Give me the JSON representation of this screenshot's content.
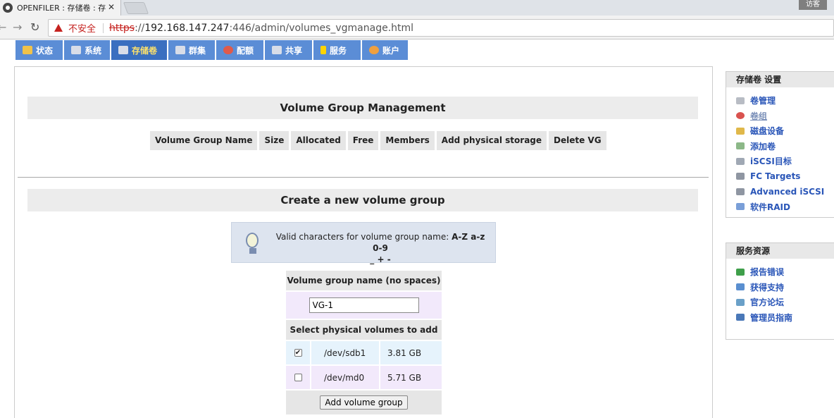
{
  "browser": {
    "tab_title": "OPENFILER : 存储卷 : 存",
    "tab_close": "✕",
    "visitor_label": "访客",
    "insecure_label": "不安全",
    "url_scheme": "https",
    "url_sep": "://",
    "url_host": "192.168.147.247",
    "url_rest": ":446/admin/volumes_vgmanage.html"
  },
  "nav": {
    "tabs": [
      {
        "label": "状态",
        "icon": "status-icon",
        "color": "#f0c24a"
      },
      {
        "label": "系统",
        "icon": "system-icon",
        "color": "#d8dde8"
      },
      {
        "label": "存储卷",
        "icon": "volumes-icon",
        "color": "#d8dde8"
      },
      {
        "label": "群集",
        "icon": "cluster-icon",
        "color": "#d8dde8"
      },
      {
        "label": "配额",
        "icon": "quota-icon",
        "color": "#e05a4a"
      },
      {
        "label": "共享",
        "icon": "shares-icon",
        "color": "#d8dde8"
      },
      {
        "label": "服务",
        "icon": "services-icon",
        "color": "#ffd400"
      },
      {
        "label": "账户",
        "icon": "accounts-icon",
        "color": "#f0a040"
      }
    ]
  },
  "vg_management": {
    "title": "Volume Group Management",
    "columns": [
      "Volume Group Name",
      "Size",
      "Allocated",
      "Free",
      "Members",
      "Add physical storage",
      "Delete VG"
    ]
  },
  "create_vg": {
    "title": "Create a new volume group",
    "tip_text": "Valid characters for volume group name: ",
    "tip_chars_1": "A-Z a-z 0-9",
    "tip_chars_2": "_ + -",
    "name_header": "Volume group name (no spaces)",
    "name_value": "VG-1",
    "pv_header": "Select physical volumes to add",
    "pvs": [
      {
        "device": "/dev/sdb1",
        "size": "3.81 GB",
        "checked": true
      },
      {
        "device": "/dev/md0",
        "size": "5.71 GB",
        "checked": false
      }
    ],
    "submit_label": "Add volume group"
  },
  "sidebar": {
    "volumes_title": "存储卷 设置",
    "volumes_items": [
      {
        "label": "卷管理",
        "icon": "volume-manage-icon"
      },
      {
        "label": "卷组",
        "icon": "volume-group-icon"
      },
      {
        "label": "磁盘设备",
        "icon": "block-devices-icon"
      },
      {
        "label": "添加卷",
        "icon": "add-volume-icon"
      },
      {
        "label": "iSCSI目标",
        "icon": "iscsi-target-icon"
      },
      {
        "label": "FC Targets",
        "icon": "fc-targets-icon"
      },
      {
        "label": "Advanced iSCSI",
        "icon": "advanced-iscsi-icon"
      },
      {
        "label": "软件RAID",
        "icon": "software-raid-icon"
      }
    ],
    "support_title": "服务资源",
    "support_items": [
      {
        "label": "报告错误",
        "icon": "report-bug-icon"
      },
      {
        "label": "获得支持",
        "icon": "get-support-icon"
      },
      {
        "label": "官方论坛",
        "icon": "forums-icon"
      },
      {
        "label": "管理员指南",
        "icon": "admin-guide-icon"
      }
    ]
  }
}
